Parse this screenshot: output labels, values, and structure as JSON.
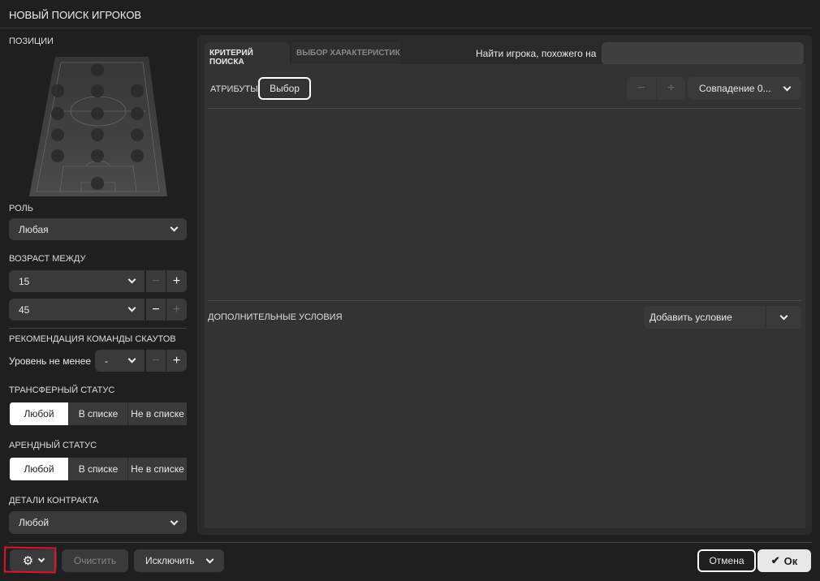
{
  "title": "НОВЫЙ ПОИСК ИГРОКОВ",
  "left": {
    "positions_label": "ПОЗИЦИИ",
    "role_label": "РОЛЬ",
    "role_value": "Любая",
    "age_label": "ВОЗРАСТ МЕЖДУ",
    "age_min": "15",
    "age_max": "45",
    "scout_label": "РЕКОМЕНДАЦИЯ КОМАНДЫ СКАУТОВ",
    "scout_level_label": "Уровень не менее",
    "scout_level_value": "-",
    "transfer_label": "ТРАНСФЕРНЫЙ СТАТУС",
    "transfer_options": [
      "Любой",
      "В списке",
      "Не в списке"
    ],
    "loan_label": "АРЕНДНЫЙ СТАТУС",
    "loan_options": [
      "Любой",
      "В списке",
      "Не в списке"
    ],
    "contract_label": "ДЕТАЛИ КОНТРАКТА",
    "contract_value": "Любой"
  },
  "main": {
    "tabs": [
      "КРИТЕРИЙ ПОИСКА",
      "ВЫБОР ХАРАКТЕРИСТИК"
    ],
    "similar_label": "Найти игрока, похожего на",
    "similar_value": "",
    "attributes_label": "АТРИБУТЫ",
    "select_button": "Выбор",
    "minus": "−",
    "plus": "+",
    "match_value": "Совпадение 0...",
    "extra_label": "ДОПОЛНИТЕЛЬНЫЕ УСЛОВИЯ",
    "add_condition": "Добавить условие"
  },
  "footer": {
    "clear": "Очистить",
    "exclude": "Исключить",
    "cancel": "Отмена",
    "ok": "Ок"
  }
}
